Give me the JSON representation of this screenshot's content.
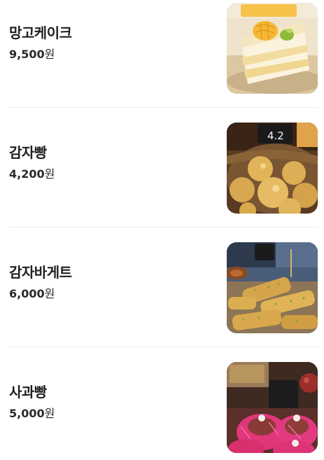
{
  "menu": {
    "currency": "원",
    "items": [
      {
        "name": "망고케이크",
        "price": "9,500",
        "image": "mango-cake-photo"
      },
      {
        "name": "감자빵",
        "price": "4,200",
        "image": "potato-bread-photo"
      },
      {
        "name": "감자바게트",
        "price": "6,000",
        "image": "potato-baguette-photo"
      },
      {
        "name": "사과빵",
        "price": "5,000",
        "image": "apple-bread-photo"
      }
    ]
  }
}
